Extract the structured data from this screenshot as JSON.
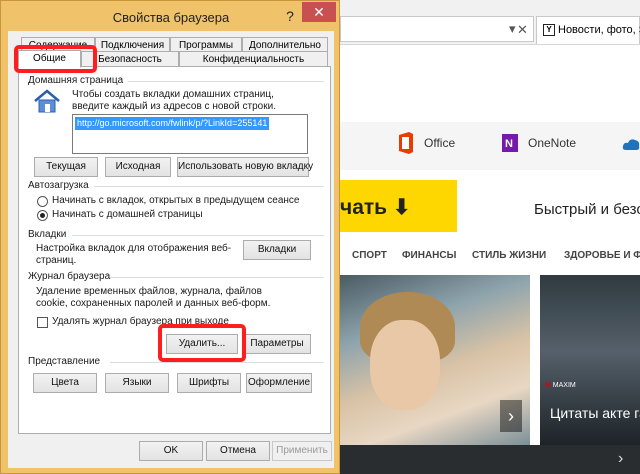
{
  "background": {
    "tab_title": "Новости, фото, Sky",
    "tab_icon": "yandex-y-icon",
    "tiles": [
      {
        "label": "Office",
        "icon": "office-icon",
        "color": "#eb3c00"
      },
      {
        "label": "OneNote",
        "icon": "onenote-icon",
        "color": "#7719aa"
      }
    ],
    "banner_yellow": "чать ⬇",
    "banner_fast": "Быстрый и безо",
    "nav": [
      "СПОРТ",
      "ФИНАНСЫ",
      "СТИЛЬ ЖИЗНИ",
      "ЗДОРОВЬЕ И ФИ"
    ],
    "photo2_text": "Цитаты акте гадости дру",
    "maxim": "MAXIM",
    "next_arrow": "›"
  },
  "dialog": {
    "title": "Свойства браузера",
    "help": "?",
    "close": "✕",
    "tabs_row1": [
      "Содержание",
      "Подключения",
      "Программы",
      "Дополнительно"
    ],
    "tabs_row2": [
      "Общие",
      "Безопасность",
      "Конфиденциальность"
    ],
    "homepage": {
      "group": "Домашняя страница",
      "hint": "Чтобы создать вкладки домашних страниц, введите каждый из адресов с новой строки.",
      "url": "http://go.microsoft.com/fwlink/p/?LinkId=255141",
      "buttons": [
        "Текущая",
        "Исходная",
        "Использовать новую вкладку"
      ]
    },
    "startup": {
      "group": "Автозагрузка",
      "option1": "Начинать с вкладок, открытых в предыдущем сеансе",
      "option2": "Начинать с домашней страницы",
      "selected": 2
    },
    "tabs_section": {
      "group": "Вкладки",
      "text": "Настройка вкладок для отображения веб-страниц.",
      "button": "Вкладки"
    },
    "history": {
      "group": "Журнал браузера",
      "text": "Удаление временных файлов, журнала, файлов cookie, сохраненных паролей и данных веб-форм.",
      "checkbox": "Удалять журнал браузера при выходе",
      "checked": false,
      "delete_button": "Удалить...",
      "params_button": "Параметры"
    },
    "appearance": {
      "group": "Представление",
      "buttons": [
        "Цвета",
        "Языки",
        "Шрифты",
        "Оформление"
      ]
    },
    "footer": {
      "ok": "OK",
      "cancel": "Отмена",
      "apply": "Применить"
    },
    "highlight_color": "#ff1e1e"
  }
}
